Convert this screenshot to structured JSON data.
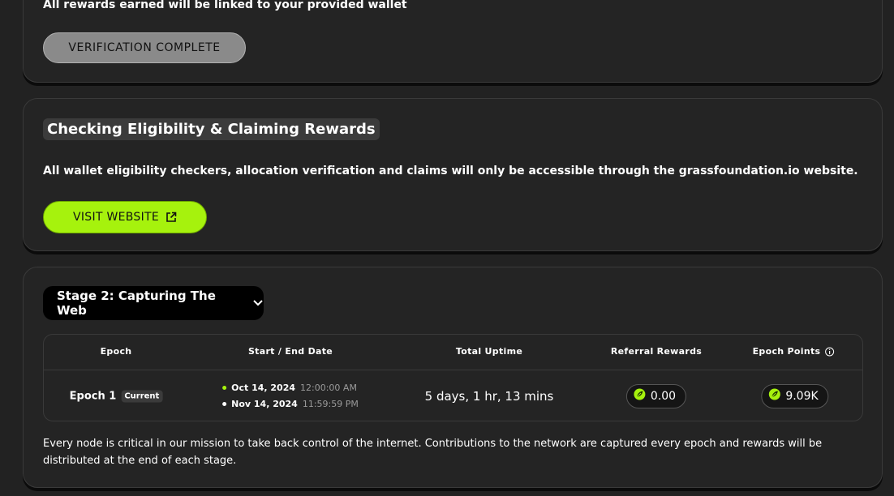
{
  "card1": {
    "note": "All rewards earned will be linked to your provided wallet",
    "button_label": "VERIFICATION COMPLETE"
  },
  "card2": {
    "title": "Checking Eligibility & Claiming Rewards",
    "description": "All wallet eligibility checkers, allocation verification and claims will only be accessible through the grassfoundation.io website.",
    "button_label": "VISIT WEBSITE",
    "button_icon": "external-link-icon"
  },
  "card3": {
    "stage_label": "Stage 2: Capturing The Web",
    "stage_icon": "chevron-down-icon",
    "table": {
      "headers": {
        "epoch": "Epoch",
        "dates": "Start / End Date",
        "uptime": "Total Uptime",
        "referral": "Referral Rewards",
        "points": "Epoch Points"
      },
      "row": {
        "epoch": "Epoch 1",
        "badge": "Current",
        "start_date": "Oct 14, 2024",
        "start_time": "12:00:00 AM",
        "end_date": "Nov 14, 2024",
        "end_time": "11:59:59 PM",
        "uptime": "5 days, 1 hr, 13 mins",
        "referral": "0.00",
        "points": "9.09K"
      }
    },
    "footer": "Every node is critical in our mission to take back control of the internet. Contributions to the network are captured every epoch and rewards will be distributed at the end of each stage."
  },
  "colors": {
    "accent": "#a6f20d",
    "background": "#222222",
    "card": "#242424"
  }
}
